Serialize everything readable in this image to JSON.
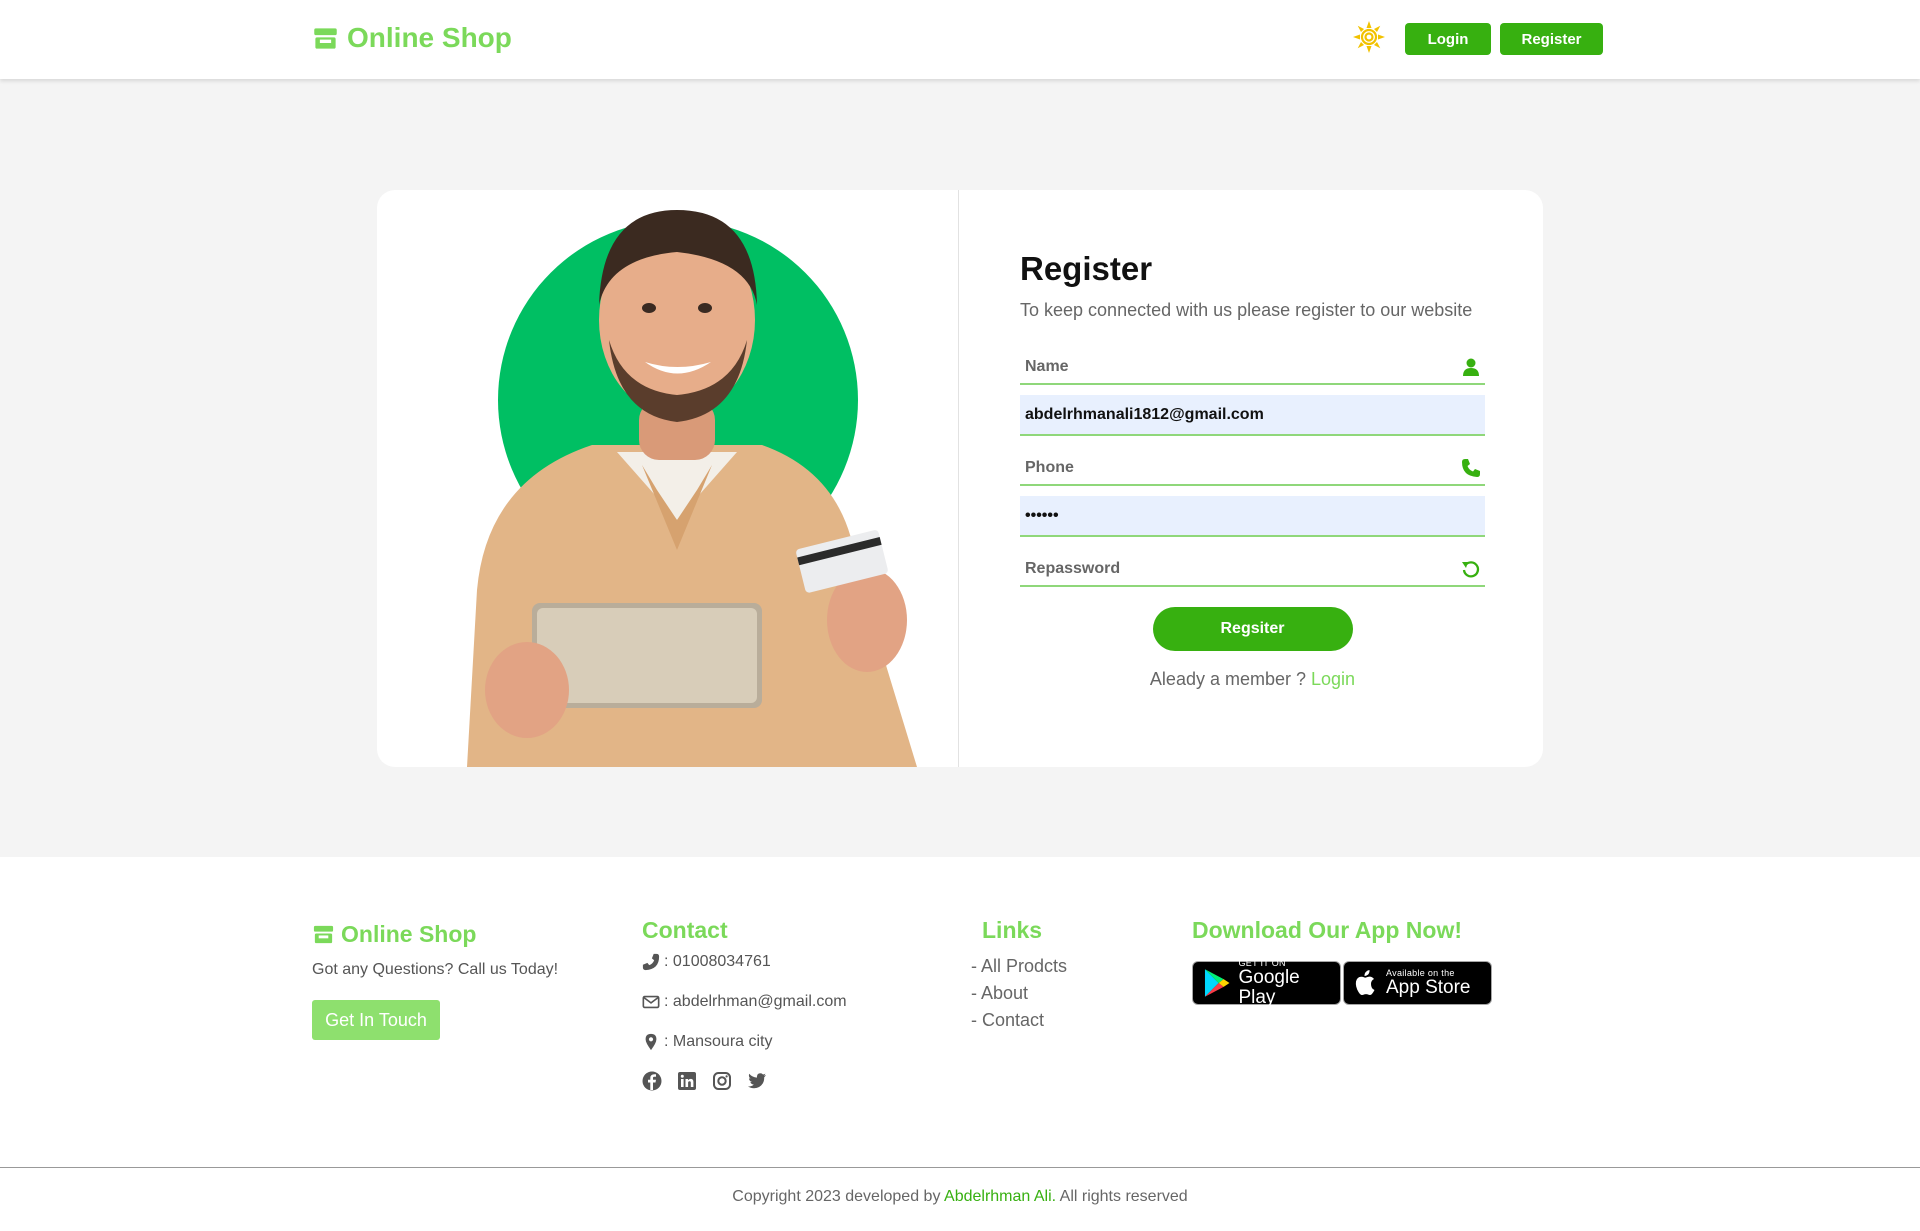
{
  "header": {
    "brand": "Online Shop",
    "login_label": "Login",
    "register_label": "Register"
  },
  "form": {
    "title": "Register",
    "subtitle": "To keep connected with us please register to our website",
    "name_placeholder": "Name",
    "email_value": "abdelrhmanali1812@gmail.com",
    "phone_placeholder": "Phone",
    "password_value": "••••••",
    "repassword_placeholder": "Repassword",
    "submit_label": "Regsiter",
    "member_text": "Aleady a member ?",
    "member_link": "Login"
  },
  "footer": {
    "brand": "Online Shop",
    "question": "Got any Questions? Call us Today!",
    "get_in_touch": "Get In Touch",
    "contact_title": "Contact",
    "phone": ": 01008034761",
    "email": ": abdelrhman@gmail.com",
    "location": ": Mansoura city",
    "links_title": "Links",
    "links": [
      "- All Prodcts",
      "- About",
      "- Contact"
    ],
    "download_title": "Download Our App Now!",
    "google_small": "GET IT ON",
    "google_big": "Google Play",
    "apple_small": "Available on the",
    "apple_big": "App Store",
    "copyright_prefix": "Copyright 2023 developed by",
    "copyright_author": "Abdelrhman Ali.",
    "copyright_suffix": "All rights reserved"
  },
  "icons": {
    "brand": "store-icon",
    "theme": "sun-icon",
    "name": "user-icon",
    "phone": "phone-icon",
    "repassword": "rotate-icon",
    "socials": [
      "facebook-icon",
      "linkedin-icon",
      "instagram-icon",
      "twitter-icon"
    ]
  },
  "colors": {
    "brand_green": "#7bd95a",
    "button_green": "#37b010",
    "circle_green": "#00bf63",
    "sun_yellow": "#f2c200"
  }
}
